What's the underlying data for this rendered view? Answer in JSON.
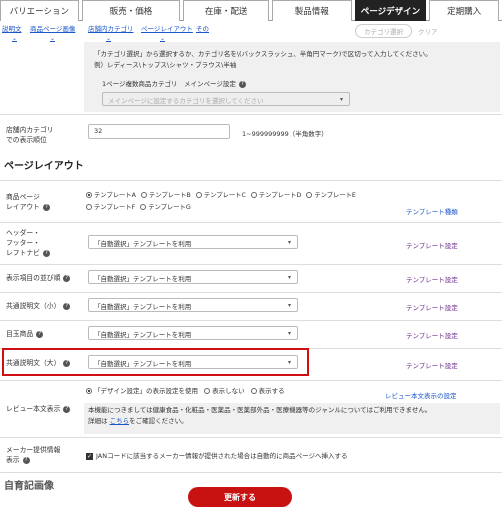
{
  "tabs": [
    {
      "label": "バリエーション"
    },
    {
      "label": "販売・価格"
    },
    {
      "label": "在庫・配送"
    },
    {
      "label": "製品情報"
    },
    {
      "label": "ページデザイン",
      "active": true
    },
    {
      "label": "定期購入"
    }
  ],
  "subnav": [
    "説明文",
    "商品ページ画像",
    "店舗内カテゴリ",
    "ページレイアウト",
    "その"
  ],
  "header_buttons": {
    "category_select": "カテゴリ選択",
    "clear": "クリア"
  },
  "category_help": {
    "line1": "「カテゴリ選択」から選択するか、カテゴリ名を\\(バックスラッシュ、半角円マーク)で区切って入力してください。",
    "line2": "例）レディース\\トップス\\シャツ・ブラウス\\半袖",
    "multi_label": "1ページ複数商品カテゴリ　メインページ設定",
    "multi_placeholder": "メインページに設定するカテゴリを選択してください"
  },
  "display_order": {
    "label_line1": "店舗内カテゴリ",
    "label_line2": "での表示順位",
    "value": "32",
    "hint": "1~999999999（半角数字）"
  },
  "layout_section_title": "ページレイアウト",
  "product_layout": {
    "label_line1": "商品ページ",
    "label_line2": "レイアウト",
    "templates_row1": [
      "テンプレートA",
      "テンプレートB",
      "テンプレートC",
      "テンプレートD",
      "テンプレートE"
    ],
    "templates_row2": [
      "テンプレートF",
      "テンプレートG"
    ],
    "sample_link": "テンプレート種類"
  },
  "rows": [
    {
      "label_lines": [
        "ヘッダー・",
        "フッター・",
        "レフトナビ"
      ],
      "value": "「自動選択」テンプレートを利用",
      "link": "テンプレート設定"
    },
    {
      "label_lines": [
        "表示項目の並び順"
      ],
      "value": "「自動選択」テンプレートを利用",
      "link": "テンプレート設定"
    },
    {
      "label_lines": [
        "共通説明文（小）"
      ],
      "value": "「自動選択」テンプレートを利用",
      "link": "テンプレート設定"
    },
    {
      "label_lines": [
        "目玉商品"
      ],
      "value": "「自動選択」テンプレートを利用",
      "link": "テンプレート設定"
    },
    {
      "label_lines": [
        "共通説明文（大）"
      ],
      "value": "「自動選択」テンプレートを利用",
      "link": "テンプレート設定"
    }
  ],
  "review": {
    "label": "レビュー本文表示",
    "options": [
      "「デザイン設定」の表示設定を使用",
      "表示しない",
      "表示する"
    ],
    "link": "レビュー本文表示の設定",
    "notice_line1": "本機能につきましては健康食品・化粧品・医薬品・医薬部外品・医療機器等のジャンルについてはご利用できません。",
    "notice_prefix": "詳細は",
    "notice_link": "こちら",
    "notice_suffix": "をご確認ください。"
  },
  "maker": {
    "label_line1": "メーカー提供情報",
    "label_line2": "表示",
    "checkbox_text": "JANコードに該当するメーカー情報が提供された場合は自動的に商品ページへ挿入する"
  },
  "next_section_title": "自育記画像",
  "submit_label": "更新する",
  "colors": {
    "accent": "#c81212",
    "link": "#1a56c8",
    "link_purple": "#6a2a8a",
    "highlight": "#d01010"
  }
}
